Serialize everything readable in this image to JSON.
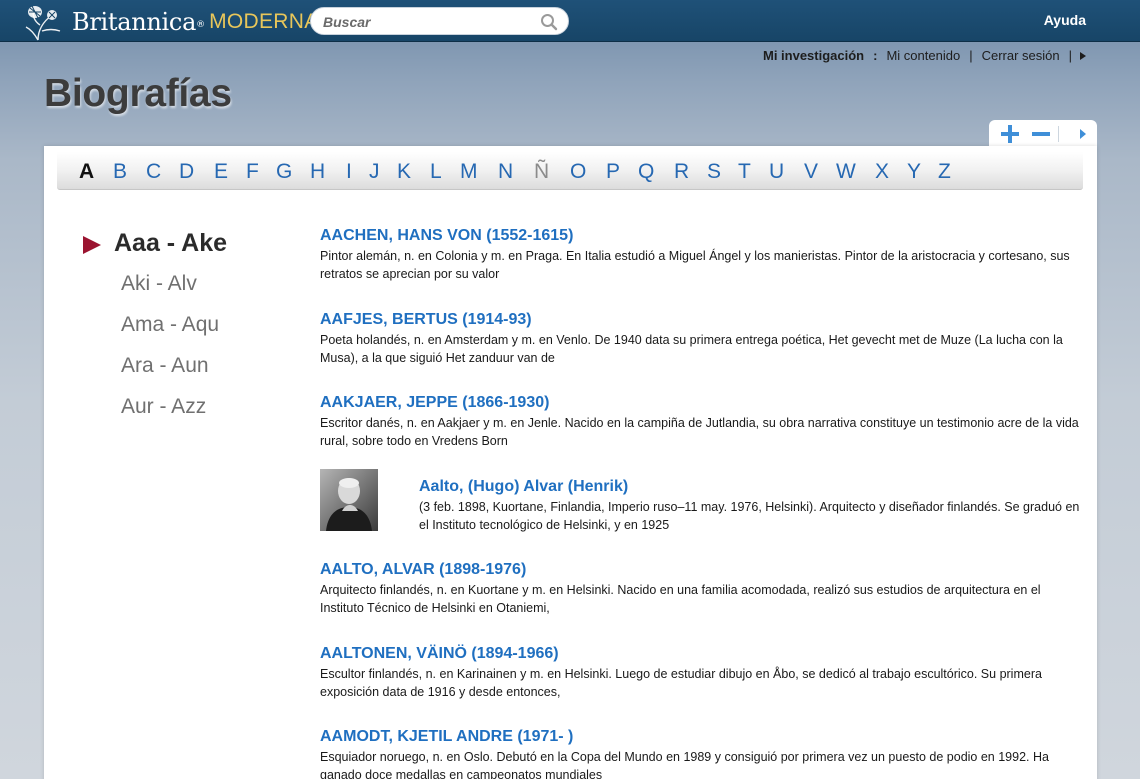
{
  "header": {
    "brand": "Britannica",
    "reg_mark": "®",
    "product": "MODERNA",
    "search_placeholder": "Buscar",
    "help": "Ayuda"
  },
  "research": {
    "label": "Mi investigación",
    "colon": ":",
    "my_content": "Mi contenido",
    "divider": "|",
    "logout": "Cerrar sesión"
  },
  "page": {
    "title": "Biografías"
  },
  "alphabet": {
    "letters": [
      "A",
      "B",
      "C",
      "D",
      "E",
      "F",
      "G",
      "H",
      "I",
      "J",
      "K",
      "L",
      "M",
      "N",
      "Ñ",
      "O",
      "P",
      "Q",
      "R",
      "S",
      "T",
      "U",
      "V",
      "W",
      "X",
      "Y",
      "Z"
    ],
    "active": "A",
    "disabled": "Ñ"
  },
  "ranges": {
    "items": [
      "Aaa - Ake",
      "Aki - Alv",
      "Ama - Aqu",
      "Ara - Aun",
      "Aur - Azz"
    ],
    "active_index": 0
  },
  "entries": [
    {
      "title": "AACHEN, HANS VON (1552-1615)",
      "desc": "Pintor alemán, n. en Colonia y m. en Praga. En Italia estudió a Miguel Ángel y los manieristas. Pintor de la aristocracia y cortesano, sus retratos se aprecian por su valor"
    },
    {
      "title": "AAFJES, BERTUS (1914-93)",
      "desc": "Poeta holandés, n. en Amsterdam y m. en Venlo. De 1940 data su primera entrega poética, Het gevecht met de Muze (La lucha con la Musa), a la que siguió Het zanduur van de"
    },
    {
      "title": "AAKJAER, JEPPE (1866-1930)",
      "desc": "Escritor danés, n. en Aakjaer y m. en Jenle. Nacido en la campiña de Jutlandia, su obra narrativa constituye un testimonio acre de la vida rural, sobre todo en Vredens Born"
    },
    {
      "title": "Aalto, (Hugo) Alvar (Henrik)",
      "desc": "(3 feb. 1898, Kuortane, Finlandia, Imperio ruso–11 may. 1976, Helsinki). Arquitecto y diseñador finlandés. Se graduó en el Instituto tecnológico de Helsinki, y en 1925",
      "image": "portrait-photo"
    },
    {
      "title": "AALTO, ALVAR (1898-1976)",
      "desc": "Arquitecto finlandés, n. en Kuortane y m. en Helsinki. Nacido en una familia acomodada, realizó sus estudios de arquitectura en el Instituto Técnico de Helsinki en Otaniemi,"
    },
    {
      "title": "AALTONEN, VÄINÖ (1894-1966)",
      "desc": "Escultor finlandés, n. en Karinainen y m. en Helsinki. Luego de estudiar dibujo en Åbo, se dedicó al trabajo escultórico. Su primera exposición data de 1916 y desde entonces,"
    },
    {
      "title": "AAMODT, KJETIL ANDRE (1971- )",
      "desc": "Esquiador noruego, n. en Oslo. Debutó en la Copa del Mundo en 1989 y consiguió por primera vez un puesto de podio en 1992. Ha ganado doce medallas en campeonatos mundiales"
    }
  ],
  "colors": {
    "header_bg": "#1f5178",
    "link": "#1f6fc0",
    "accent_arrow": "#9b1430",
    "moderna": "#e8c65a"
  }
}
